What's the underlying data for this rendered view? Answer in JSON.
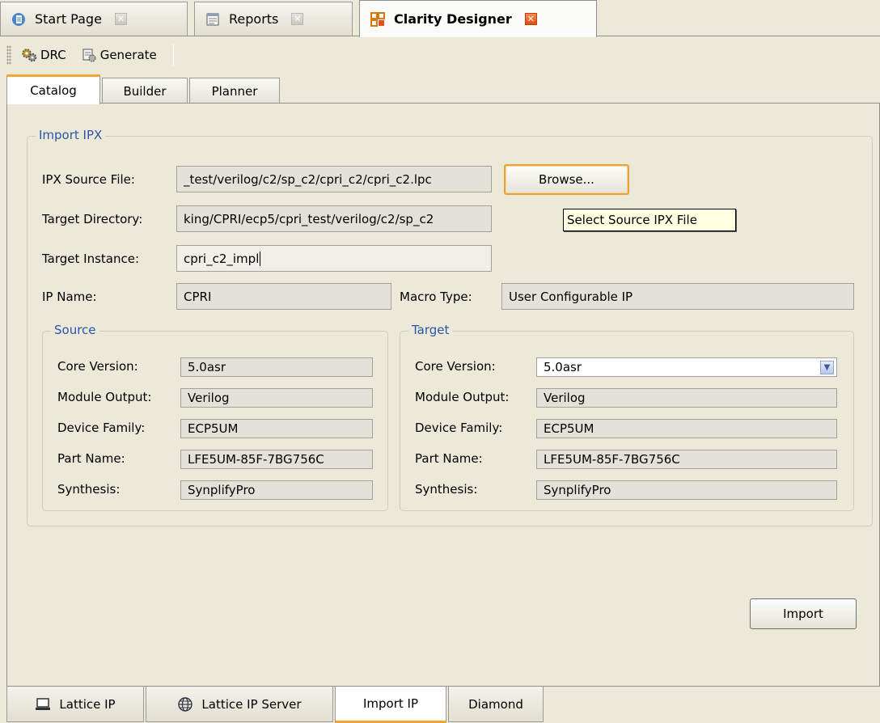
{
  "doc_tabs": [
    {
      "label": "Start Page",
      "icon": "start-page-icon"
    },
    {
      "label": "Reports",
      "icon": "reports-icon"
    },
    {
      "label": "Clarity Designer",
      "icon": "clarity-designer-icon"
    }
  ],
  "toolbar": {
    "drc_label": "DRC",
    "generate_label": "Generate"
  },
  "inner_tabs": [
    "Catalog",
    "Builder",
    "Planner"
  ],
  "import_group": {
    "title": "Import IPX",
    "ipx_source_label": "IPX Source File:",
    "ipx_source_value": "_test/verilog/c2/sp_c2/cpri_c2/cpri_c2.lpc",
    "browse_label": "Browse...",
    "tooltip": "Select Source IPX File",
    "target_dir_label": "Target Directory:",
    "target_dir_value": "king/CPRI/ecp5/cpri_test/verilog/c2/sp_c2",
    "target_instance_label": "Target Instance:",
    "target_instance_value": "cpri_c2_impl",
    "ip_name_label": "IP Name:",
    "ip_name_value": "CPRI",
    "macro_type_label": "Macro Type:",
    "macro_type_value": "User Configurable IP"
  },
  "source": {
    "title": "Source",
    "rows": [
      {
        "label": "Core Version:",
        "value": "5.0asr"
      },
      {
        "label": "Module Output:",
        "value": "Verilog"
      },
      {
        "label": "Device Family:",
        "value": "ECP5UM"
      },
      {
        "label": "Part Name:",
        "value": "LFE5UM-85F-7BG756C"
      },
      {
        "label": "Synthesis:",
        "value": "SynplifyPro"
      }
    ]
  },
  "target": {
    "title": "Target",
    "rows": [
      {
        "label": "Core Version:",
        "value": "5.0asr"
      },
      {
        "label": "Module Output:",
        "value": "Verilog"
      },
      {
        "label": "Device Family:",
        "value": "ECP5UM"
      },
      {
        "label": "Part Name:",
        "value": "LFE5UM-85F-7BG756C"
      },
      {
        "label": "Synthesis:",
        "value": "SynplifyPro"
      }
    ]
  },
  "import_label": "Import",
  "bottom_tabs": [
    {
      "label": "Lattice IP",
      "icon": "computer-icon"
    },
    {
      "label": "Lattice IP Server",
      "icon": "globe-icon"
    },
    {
      "label": "Import IP",
      "icon": ""
    },
    {
      "label": "Diamond",
      "icon": ""
    }
  ],
  "colors": {
    "accent": "#f0a830",
    "group_title": "#2c54a8",
    "tooltip_bg": "#ffffe1"
  }
}
